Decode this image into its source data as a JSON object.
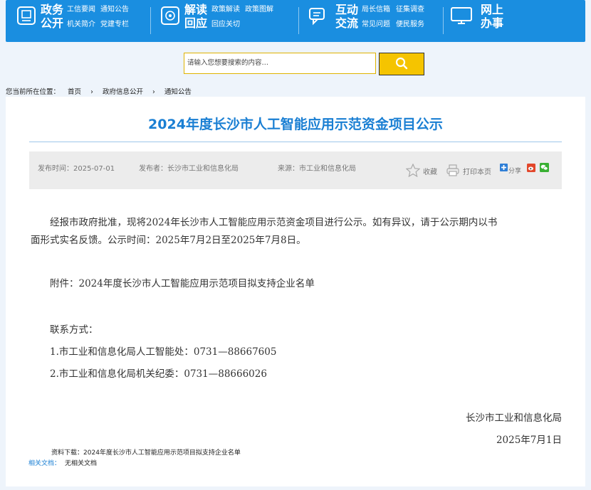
{
  "nav": {
    "groups": [
      {
        "title1": "政务",
        "title2": "公开",
        "links": [
          "工信要闻",
          "通知公告",
          "机关简介",
          "党建专栏"
        ],
        "icon": "document-icon"
      },
      {
        "title1": "解读",
        "title2": "回应",
        "links": [
          "政策解读",
          "政策图解",
          "回应关切"
        ],
        "icon": "interpret-icon"
      },
      {
        "title1": "互动",
        "title2": "交流",
        "links": [
          "局长信箱",
          "征集调查",
          "常见问题",
          "便民服务"
        ],
        "icon": "chat-icon"
      },
      {
        "title1": "网上",
        "title2": "办事",
        "links": [],
        "icon": "monitor-icon"
      }
    ]
  },
  "search": {
    "placeholder": "请输入您想要搜索的内容…",
    "value": "请输入您想要搜索的内容…",
    "button_icon": "search-icon"
  },
  "breadcrumb": {
    "prefix": "您当前所在位置：",
    "items": [
      "首页",
      "政府信息公开",
      "通知公告"
    ],
    "separator": "›"
  },
  "article": {
    "title": "2024年度长沙市人工智能应用示范资金项目公示",
    "meta": {
      "date": "发布时间：2025-07-01",
      "publisher": "发布者：长沙市工业和信息化局",
      "source": "来源：市工业和信息化局",
      "favorite": "收藏",
      "print": "打印本页",
      "share": "分享"
    },
    "para1_line1": "经报市政府批准，现将2024年长沙市人工智能应用示范资金项目进行公示。如有异议，请于公示期内以书",
    "para1_line2": "面形式实名反馈。公示时间：2025年7月2日至2025年7月8日。",
    "attachment": "附件：2024年度长沙市人工智能应用示范项目拟支持企业名单",
    "contact_title": "联系方式：",
    "contact1": "1.市工业和信息化局人工智能处：0731—88667605",
    "contact2": "2.市工业和信息化局机关纪委：0731—88666026",
    "signature": "长沙市工业和信息化局",
    "sign_date": "2025年7月1日"
  },
  "footer": {
    "download_label": "资料下载：",
    "download_file": "2024年度长沙市人工智能应用示范项目拟支持企业名单",
    "related_label": "相关文档：",
    "related_value": "无相关文档"
  },
  "colors": {
    "nav_bg": "#1a8ee0",
    "title": "#1a7fd3",
    "search_button": "#f5c400"
  }
}
